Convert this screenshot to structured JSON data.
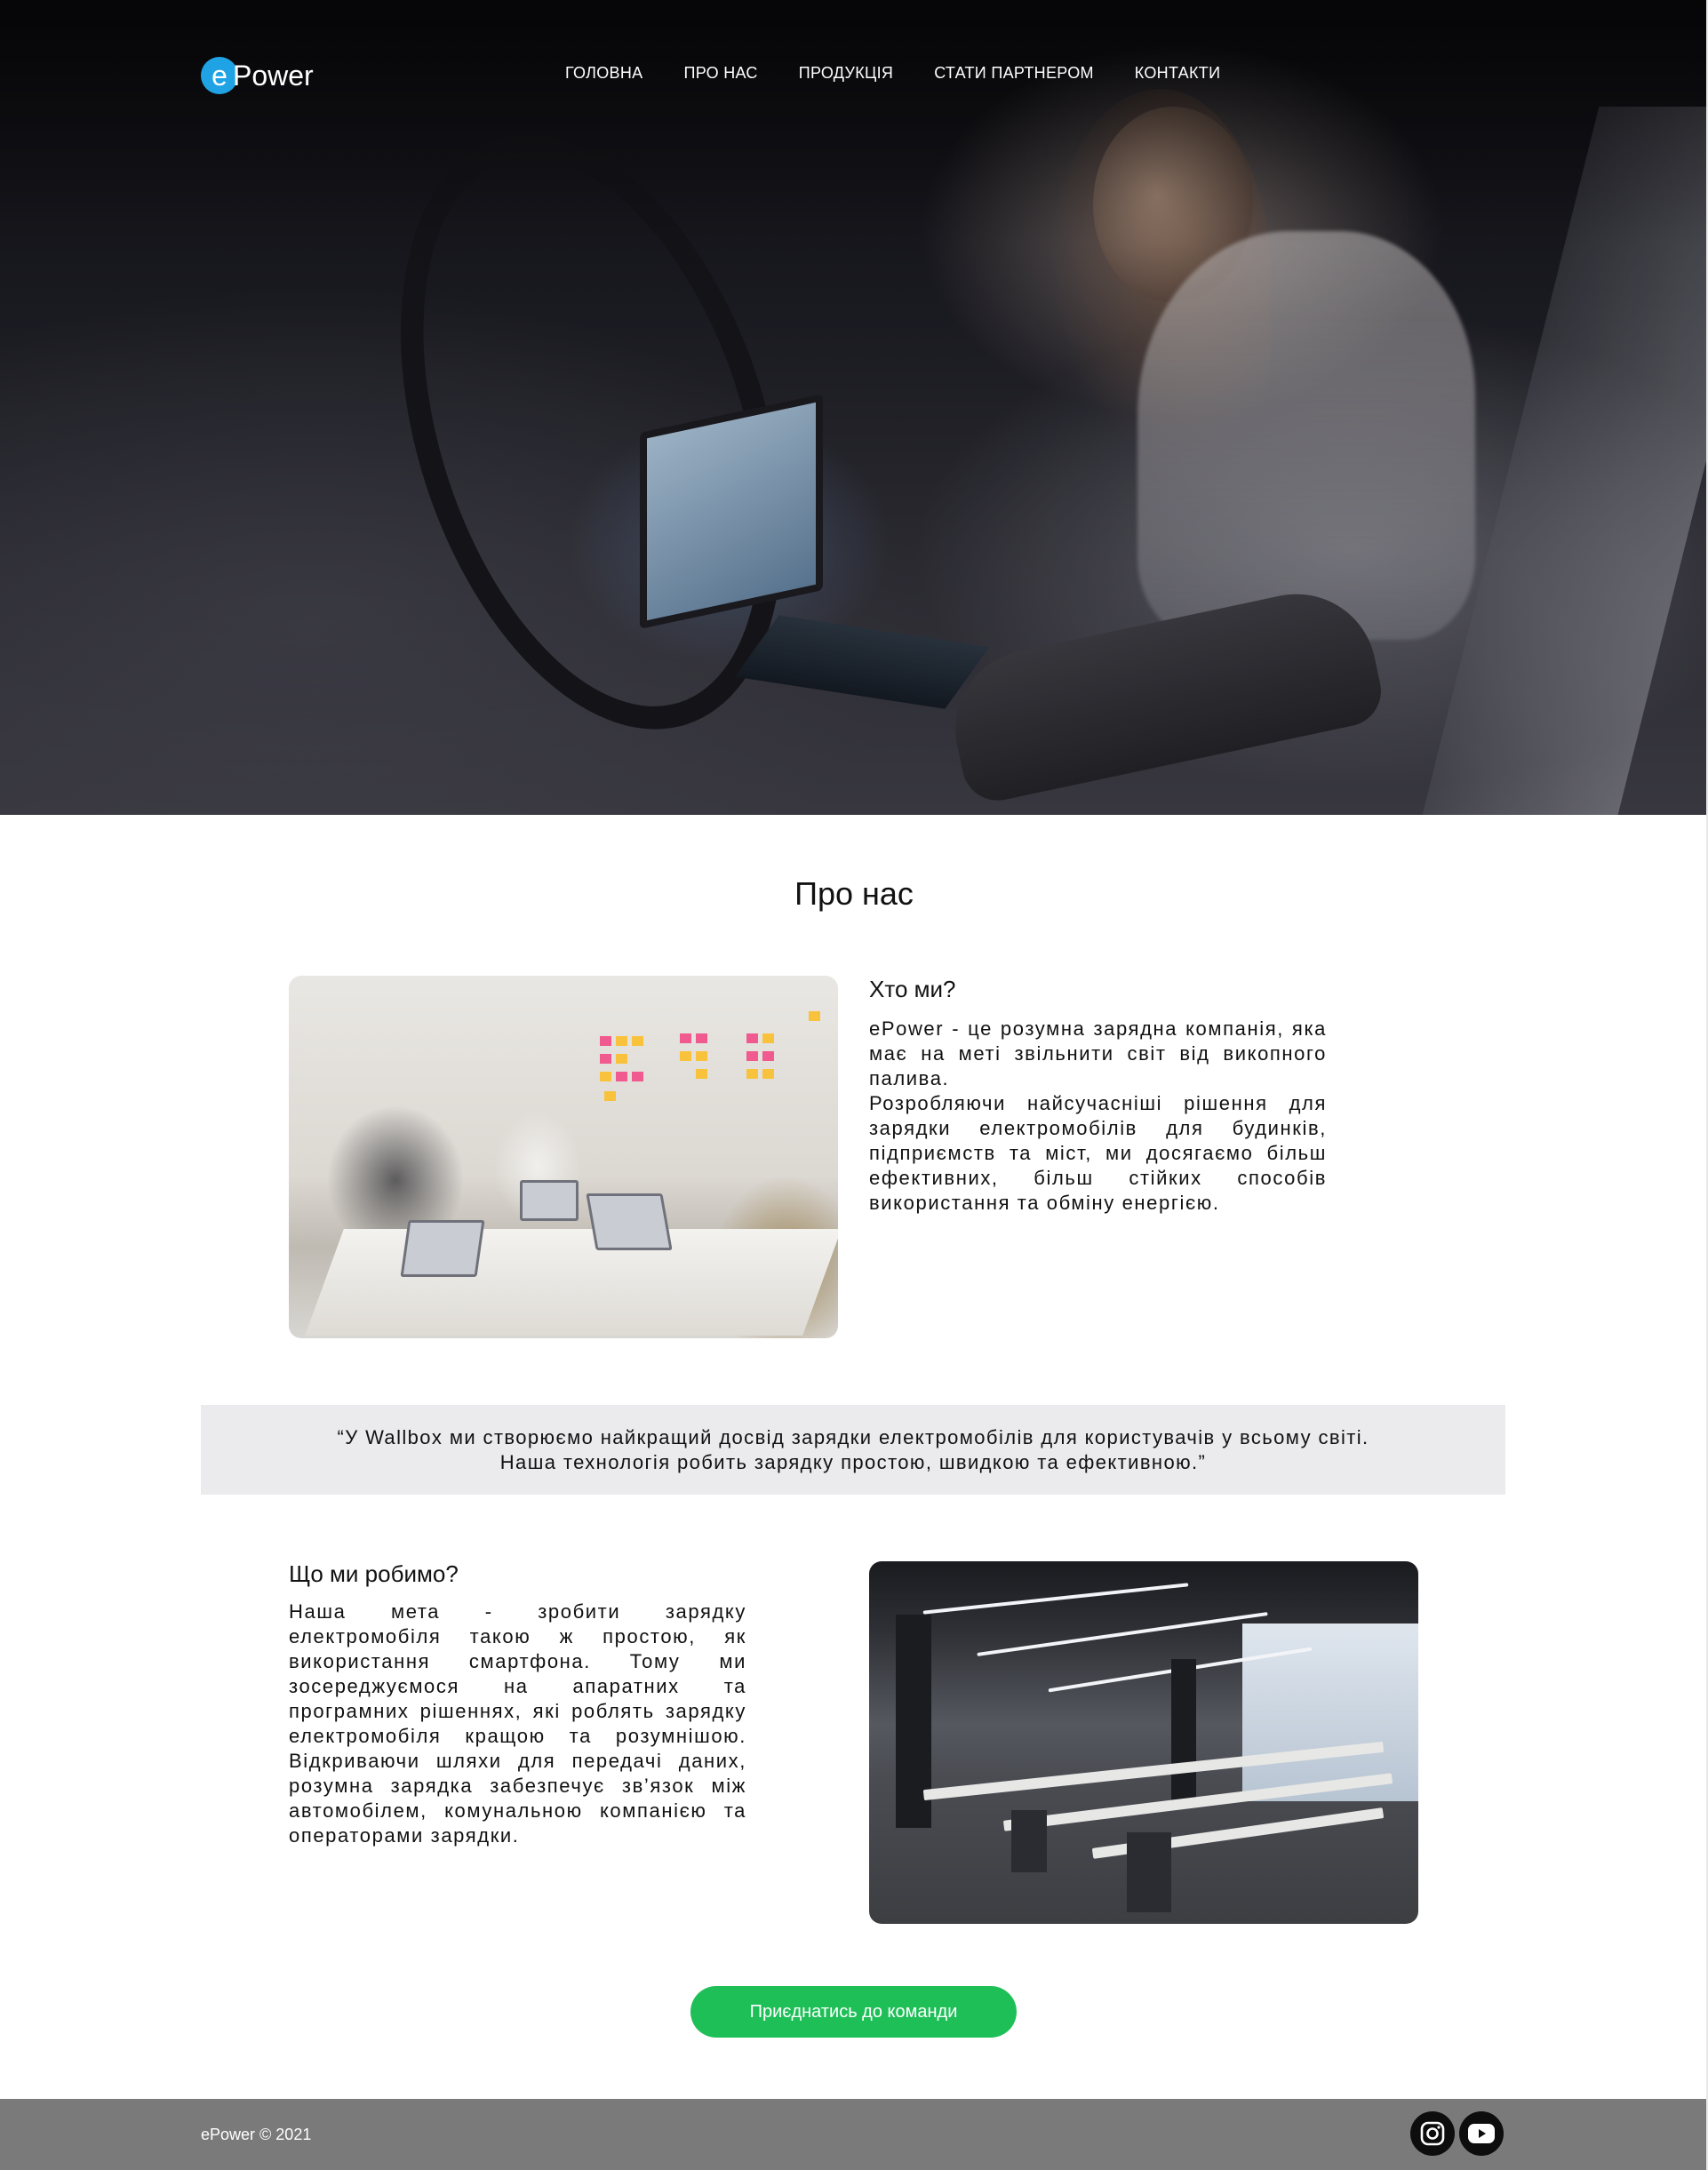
{
  "brand": {
    "logo_letter": "e",
    "logo_rest": "Power"
  },
  "nav": {
    "items": [
      "Головна",
      "Про нас",
      "Продукція",
      "Стати партнером",
      "Контакти"
    ]
  },
  "about": {
    "title": "Про нас",
    "who": {
      "heading": "Хто ми?",
      "text": "ePower - це розумна зарядна компанія, яка має на меті звільнити світ від викопного палива.",
      "text2": "Розробляючи найсучасніші рішення для зарядки електромобілів для будинків, підприємств та міст, ми досягаємо більш ефективних, більш стійких способів використання та обміну енергією."
    },
    "quote": {
      "line1": "“У Wallbox ми створюємо найкращий досвід зарядки електромобілів для користувачів у всьому світі.",
      "line2": "Наша технологія робить зарядку простою, швидкою та ефективною.”"
    },
    "what": {
      "heading": "Що ми робимо?",
      "text": "Наша мета - зробити зарядку електромобіля такою ж простою, як використання смартфона. Тому ми зосереджуємося на апаратних та програмних рішеннях, які роблять зарядку електромобіля кращою та розумнішою. Відкриваючи шляхи для передачі даних, розумна зарядка забезпечує зв’язок між автомобілем, комунальною компанією та операторами зарядки."
    },
    "join_button": "Приєднатись до команди"
  },
  "footer": {
    "copyright": "ePower © 2021",
    "social": [
      "instagram-icon",
      "youtube-icon"
    ]
  },
  "colors": {
    "accent": "#1fbf58",
    "logo_circle": "#1fa3e4",
    "footer_bg": "#7a7a7a",
    "quote_bg": "#ebebed"
  }
}
